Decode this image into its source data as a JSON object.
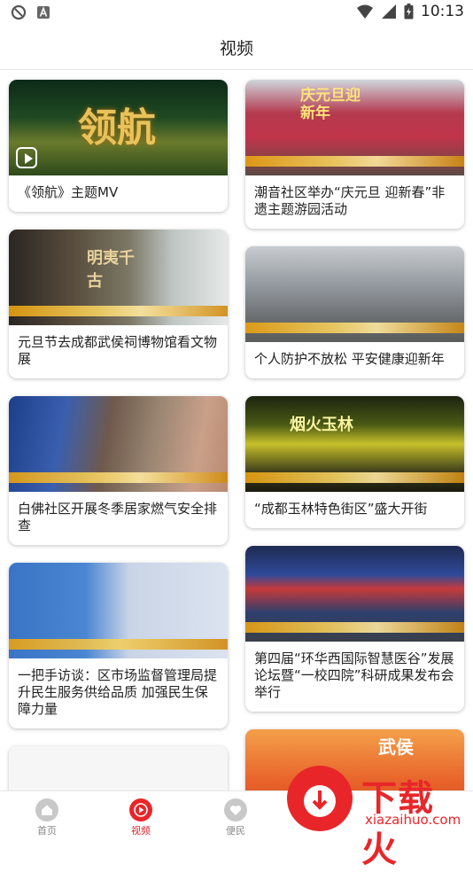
{
  "status_bar": {
    "time": "10:13"
  },
  "header": {
    "title": "视频"
  },
  "feed": {
    "left": [
      {
        "title": "《领航》主题MV",
        "thumb_text": "领航"
      },
      {
        "title": "元旦节去成都武侯祠博物馆看文物展",
        "thumb_text": "明夷千古"
      },
      {
        "title": "白佛社区开展冬季居家燃气安全排查"
      },
      {
        "title": "一把手访谈：区市场监督管理局提升民生服务供给品质 加强民生保障力量"
      }
    ],
    "right": [
      {
        "title": "潮音社区举办“庆元旦 迎新春”非遗主题游园活动",
        "thumb_text": "庆元旦迎新年"
      },
      {
        "title": "个人防护不放松 平安健康迎新年"
      },
      {
        "title": "“成都玉林特色街区”盛大开街",
        "thumb_text": "烟火玉林"
      },
      {
        "title": "第四届“环华西国际智慧医谷”发展论坛暨“一校四院”科研成果发布会举行"
      },
      {
        "title": "",
        "thumb_text": "武侯"
      }
    ]
  },
  "tabbar": {
    "tabs": [
      {
        "label": "首页",
        "icon": "home-icon"
      },
      {
        "label": "视频",
        "icon": "video-icon"
      },
      {
        "label": "便民",
        "icon": "heart-icon"
      }
    ],
    "active_color": "#d8262a"
  },
  "watermark": {
    "text": "下载火",
    "url": "xiazaihuo.com"
  }
}
